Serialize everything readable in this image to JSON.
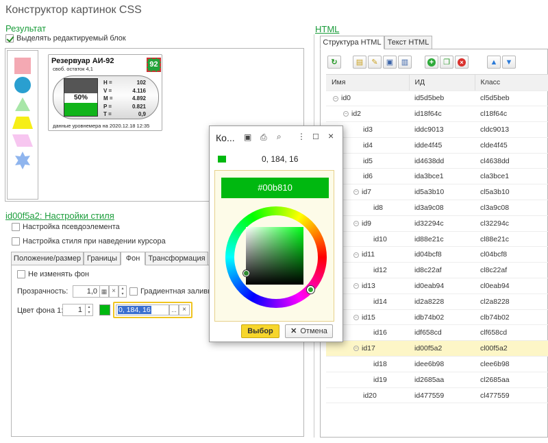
{
  "window_title": "Конструктор картинок CSS",
  "result": {
    "title": "Результат",
    "highlight_label": "Выделять редактируемый блок",
    "tank": {
      "name": "Резервуар АИ-92",
      "badge": "92",
      "free_rest": "своб. остаток 4,1",
      "level": "50%",
      "level_fraction": 0.5,
      "params": [
        {
          "k": "H =",
          "v": "102"
        },
        {
          "k": "V =",
          "v": "4.116"
        },
        {
          "k": "M =",
          "v": "4.892"
        },
        {
          "k": "P =",
          "v": "0.821"
        },
        {
          "k": "T =",
          "v": "0,9"
        }
      ],
      "footer": "данные уровнемера на 2020.12.18 12:35"
    },
    "shape_colors": [
      "#f4a9b3",
      "#2a9fd0",
      "#a8e6a8",
      "#f6ee17",
      "#f7c6f0",
      "#8fb5ee"
    ]
  },
  "style": {
    "title": "id00f5a2: Настройки стиля",
    "pseudo_label": "Настройка псевдоэлемента",
    "hover_label": "Настройка стиля при наведении курсора",
    "tabs": [
      "Положение/размер",
      "Границы",
      "Фон",
      "Трансформация"
    ],
    "no_change_bg": "Не изменять фон",
    "opacity_label": "Прозрачность:",
    "opacity_value": "1,0",
    "gradient_label": "Градиентная заливка",
    "bg_color_label": "Цвет фона 1:",
    "bg_color_index": "1",
    "bg_color_value": "0, 184, 16",
    "bg_color_hex": "#00b810"
  },
  "html_panel": {
    "title": "HTML",
    "tabs": [
      "Структура HTML",
      "Текст HTML"
    ],
    "columns": [
      "Имя",
      "ИД",
      "Класс"
    ],
    "rows": [
      {
        "name": "id0",
        "id": "id5d5beb",
        "cls": "cl5d5beb",
        "depth": 0,
        "toggle": true
      },
      {
        "name": "id2",
        "id": "id18f64c",
        "cls": "cl18f64c",
        "depth": 1,
        "toggle": true
      },
      {
        "name": "id3",
        "id": "iddc9013",
        "cls": "cldc9013",
        "depth": 2,
        "toggle": false
      },
      {
        "name": "id4",
        "id": "idde4f45",
        "cls": "clde4f45",
        "depth": 2,
        "toggle": false
      },
      {
        "name": "id5",
        "id": "id4638dd",
        "cls": "cl4638dd",
        "depth": 2,
        "toggle": false
      },
      {
        "name": "id6",
        "id": "ida3bce1",
        "cls": "cla3bce1",
        "depth": 2,
        "toggle": false
      },
      {
        "name": "id7",
        "id": "id5a3b10",
        "cls": "cl5a3b10",
        "depth": 2,
        "toggle": true
      },
      {
        "name": "id8",
        "id": "id3a9c08",
        "cls": "cl3a9c08",
        "depth": 3,
        "toggle": false
      },
      {
        "name": "id9",
        "id": "id32294c",
        "cls": "cl32294c",
        "depth": 2,
        "toggle": true
      },
      {
        "name": "id10",
        "id": "id88e21c",
        "cls": "cl88e21c",
        "depth": 3,
        "toggle": false
      },
      {
        "name": "id11",
        "id": "id04bcf8",
        "cls": "cl04bcf8",
        "depth": 2,
        "toggle": true
      },
      {
        "name": "id12",
        "id": "id8c22af",
        "cls": "cl8c22af",
        "depth": 3,
        "toggle": false
      },
      {
        "name": "id13",
        "id": "id0eab94",
        "cls": "cl0eab94",
        "depth": 2,
        "toggle": true
      },
      {
        "name": "id14",
        "id": "id2a8228",
        "cls": "cl2a8228",
        "depth": 3,
        "toggle": false
      },
      {
        "name": "id15",
        "id": "idb74b02",
        "cls": "clb74b02",
        "depth": 2,
        "toggle": true
      },
      {
        "name": "id16",
        "id": "idf658cd",
        "cls": "clf658cd",
        "depth": 3,
        "toggle": false
      },
      {
        "name": "id17",
        "id": "id00f5a2",
        "cls": "cl00f5a2",
        "depth": 2,
        "toggle": true,
        "selected": true
      },
      {
        "name": "id18",
        "id": "idee6b98",
        "cls": "clee6b98",
        "depth": 3,
        "toggle": false
      },
      {
        "name": "id19",
        "id": "id2685aa",
        "cls": "cl2685aa",
        "depth": 3,
        "toggle": false
      },
      {
        "name": "id20",
        "id": "id477559",
        "cls": "cl477559",
        "depth": 2,
        "toggle": false
      }
    ]
  },
  "dialog": {
    "title": "Ко...",
    "rgb": "0, 184, 16",
    "hex": "#00b810",
    "ok_label": "Выбор",
    "cancel_label": "Отмена"
  }
}
